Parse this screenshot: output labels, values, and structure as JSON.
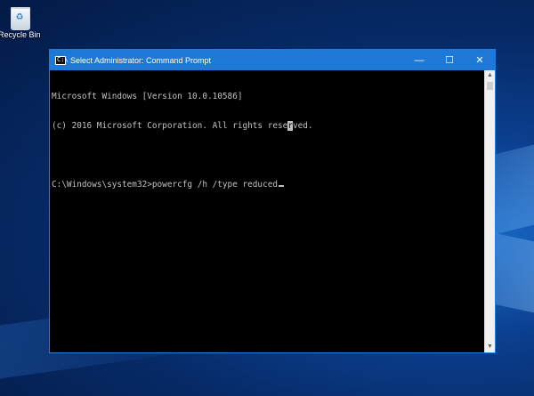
{
  "desktop": {
    "recycle_bin_label": "Recycle Bin"
  },
  "window": {
    "title": "Select Administrator: Command Prompt",
    "icon_label": "C:\\",
    "minimize_glyph": "—",
    "maximize_glyph": "☐",
    "close_glyph": "✕",
    "accent_color": "#1e78d6"
  },
  "console": {
    "line1": "Microsoft Windows [Version 10.0.10586]",
    "line2_before_selection": "(c) 2016 Microsoft Corporation. All rights rese",
    "line2_selected": "r",
    "line2_after_selection": "ved.",
    "line3": "",
    "prompt": "C:\\Windows\\system32>",
    "command": "powercfg /h /type reduced",
    "text_color": "#c0c0c0",
    "background_color": "#000000"
  },
  "scrollbar": {
    "up_glyph": "▲",
    "down_glyph": "▼"
  }
}
